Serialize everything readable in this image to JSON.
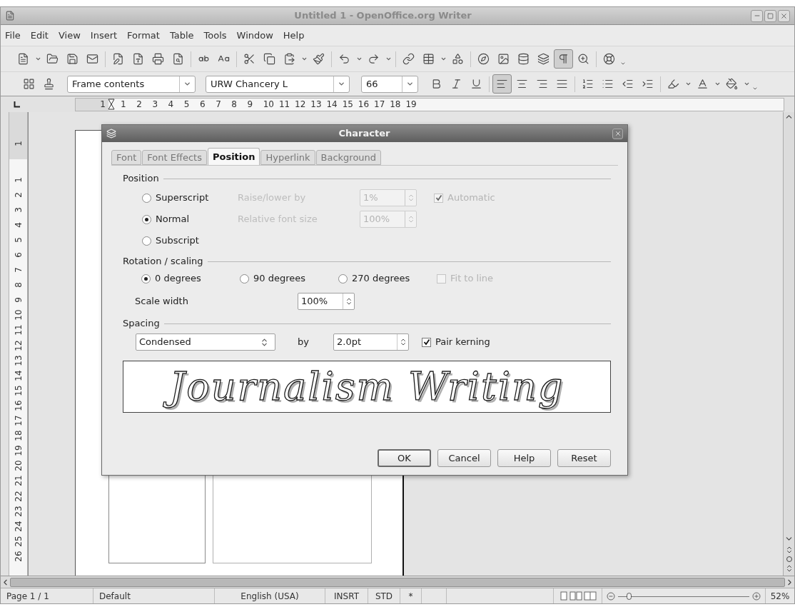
{
  "window": {
    "title": "Untitled 1 - OpenOffice.org Writer"
  },
  "menu": [
    "File",
    "Edit",
    "View",
    "Insert",
    "Format",
    "Table",
    "Tools",
    "Window",
    "Help"
  ],
  "standard_toolbar": [
    {
      "kind": "new",
      "pressed": false
    },
    {
      "kind": "caret",
      "pressed": false
    },
    {
      "kind": "open",
      "pressed": false
    },
    {
      "kind": "save",
      "pressed": false
    },
    {
      "kind": "mail",
      "pressed": false
    },
    {
      "kind": "separator"
    },
    {
      "kind": "edit",
      "pressed": false
    },
    {
      "kind": "pdf",
      "pressed": false
    },
    {
      "kind": "print",
      "pressed": false
    },
    {
      "kind": "preview",
      "pressed": false
    },
    {
      "kind": "separator"
    },
    {
      "kind": "spellcheck",
      "pressed": false
    },
    {
      "kind": "autospell",
      "pressed": false
    },
    {
      "kind": "separator"
    },
    {
      "kind": "cut",
      "pressed": false
    },
    {
      "kind": "copy",
      "pressed": false
    },
    {
      "kind": "paste",
      "pressed": false
    },
    {
      "kind": "caret",
      "pressed": false
    },
    {
      "kind": "clone",
      "pressed": false
    },
    {
      "kind": "separator"
    },
    {
      "kind": "undo",
      "pressed": false
    },
    {
      "kind": "caret",
      "pressed": false
    },
    {
      "kind": "redo",
      "pressed": false
    },
    {
      "kind": "caret",
      "pressed": false
    },
    {
      "kind": "separator"
    },
    {
      "kind": "hyperlink",
      "pressed": false
    },
    {
      "kind": "table",
      "pressed": false
    },
    {
      "kind": "caret",
      "pressed": false
    },
    {
      "kind": "draw",
      "pressed": false
    },
    {
      "kind": "separator"
    },
    {
      "kind": "navigator",
      "pressed": false
    },
    {
      "kind": "gallery",
      "pressed": false
    },
    {
      "kind": "datasource",
      "pressed": false
    },
    {
      "kind": "fields",
      "pressed": false
    },
    {
      "kind": "pilcrow",
      "pressed": true
    },
    {
      "kind": "zoom",
      "pressed": false
    },
    {
      "kind": "separator"
    },
    {
      "kind": "help",
      "pressed": false
    },
    {
      "kind": "overflow",
      "pressed": false
    }
  ],
  "formatting_toolbar": {
    "left": [
      {
        "kind": "styles",
        "pressed": false
      },
      {
        "kind": "stylist",
        "pressed": false
      }
    ],
    "paragraph_style": "Frame contents",
    "font_name": "URW Chancery L",
    "font_size": "66",
    "right": [
      {
        "kind": "bold",
        "pressed": false
      },
      {
        "kind": "italic",
        "pressed": false
      },
      {
        "kind": "underline",
        "pressed": false
      },
      {
        "kind": "separator"
      },
      {
        "kind": "align-left",
        "pressed": true
      },
      {
        "kind": "align-center",
        "pressed": false
      },
      {
        "kind": "align-right",
        "pressed": false
      },
      {
        "kind": "justify",
        "pressed": false
      },
      {
        "kind": "separator"
      },
      {
        "kind": "numbering",
        "pressed": false
      },
      {
        "kind": "bullets",
        "pressed": false
      },
      {
        "kind": "outdent",
        "pressed": false
      },
      {
        "kind": "indent",
        "pressed": false
      },
      {
        "kind": "separator"
      },
      {
        "kind": "highlight",
        "pressed": false
      },
      {
        "kind": "caret",
        "pressed": false
      },
      {
        "kind": "fontcolor",
        "pressed": false
      },
      {
        "kind": "caret",
        "pressed": false
      },
      {
        "kind": "background",
        "pressed": false
      },
      {
        "kind": "caret",
        "pressed": false
      },
      {
        "kind": "overflow",
        "pressed": false
      }
    ]
  },
  "ruler": {
    "horizontal": [
      "1",
      "1",
      "2",
      "3",
      "4",
      "5",
      "6",
      "7",
      "8",
      "9",
      "10",
      "11",
      "12",
      "13",
      "14",
      "15",
      "16",
      "17",
      "18",
      "19"
    ],
    "vertical": [
      "1",
      "1",
      "2",
      "3",
      "4",
      "5",
      "6",
      "7",
      "8",
      "9",
      "10",
      "11",
      "12",
      "13",
      "14",
      "15",
      "16",
      "17",
      "18",
      "19",
      "20",
      "21",
      "22",
      "23",
      "24",
      "25",
      "26"
    ]
  },
  "dialog": {
    "title": "Character",
    "tabs": [
      {
        "label": "Font",
        "selected": false
      },
      {
        "label": "Font Effects",
        "selected": false
      },
      {
        "label": "Position",
        "selected": true
      },
      {
        "label": "Hyperlink",
        "selected": false
      },
      {
        "label": "Background",
        "selected": false
      }
    ],
    "position_section": {
      "title": "Position",
      "options": [
        {
          "label": "Superscript",
          "selected": false
        },
        {
          "label": "Normal",
          "selected": true
        },
        {
          "label": "Subscript",
          "selected": false
        }
      ],
      "raise_lower": {
        "label": "Raise/lower by",
        "value": "1%",
        "disabled": true
      },
      "automatic": {
        "label": "Automatic",
        "checked": true,
        "disabled": true
      },
      "relative_size": {
        "label": "Relative font size",
        "value": "100%",
        "disabled": true
      }
    },
    "rotation_section": {
      "title": "Rotation / scaling",
      "options": [
        {
          "label": "0 degrees",
          "selected": true
        },
        {
          "label": "90 degrees",
          "selected": false
        },
        {
          "label": "270 degrees",
          "selected": false
        }
      ],
      "fit_to_line": {
        "label": "Fit to line",
        "checked": false,
        "disabled": true
      },
      "scale_width": {
        "label": "Scale width",
        "value": "100%"
      }
    },
    "spacing_section": {
      "title": "Spacing",
      "mode": "Condensed",
      "by_label": "by",
      "value": "2.0pt",
      "pair_kerning": {
        "label": "Pair kerning",
        "checked": true,
        "disabled": false
      }
    },
    "preview_text": "Journalism Writing",
    "buttons": [
      {
        "label": "OK",
        "default": true
      },
      {
        "label": "Cancel",
        "default": false
      },
      {
        "label": "Help",
        "default": false
      },
      {
        "label": "Reset",
        "default": false
      }
    ]
  },
  "status_bar": {
    "cells": [
      "Page 1 / 1",
      "Default",
      "English (USA)",
      "INSRT",
      "STD",
      "*"
    ],
    "zoom": {
      "level": 0.08,
      "value": "52%"
    }
  }
}
